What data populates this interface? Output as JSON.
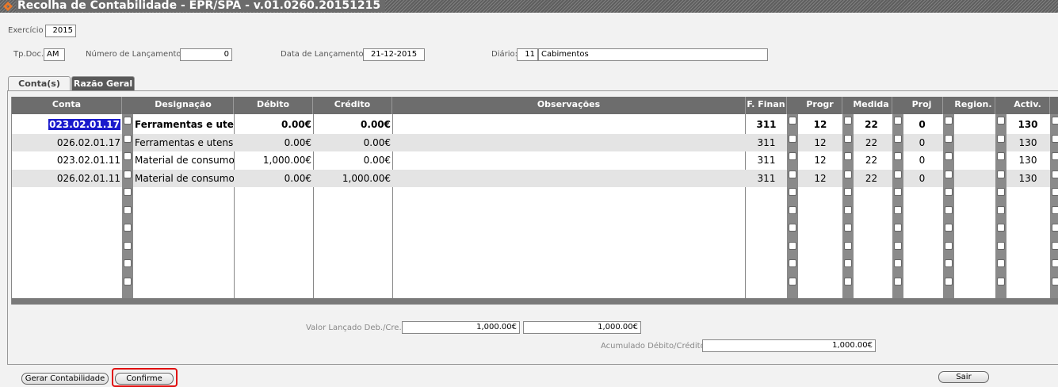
{
  "window": {
    "title": "Recolha de Contabilidade - EPR/SPA - v.01.0260.20151215"
  },
  "header": {
    "exercicio_label": "Exercício",
    "exercicio_value": "2015",
    "tpdoc_label": "Tp.Doc.",
    "tpdoc_value": "AM",
    "numero_label": "Número de Lançamento:",
    "numero_value": "0",
    "data_label": "Data de Lançamento:",
    "data_value": "21-12-2015",
    "diario_label": "Diário:",
    "diario_code": "11",
    "diario_name": "Cabimentos"
  },
  "tabs": [
    {
      "label": "Conta(s)",
      "active": false
    },
    {
      "label": "Razão Geral",
      "active": true
    }
  ],
  "table": {
    "columns": [
      "Conta",
      "Designação",
      "Débito",
      "Crédito",
      "Observações",
      "F. Finan",
      "Progr",
      "Medida",
      "Proj",
      "Region.",
      "Activ."
    ],
    "rows": [
      {
        "conta": "023.02.01.17",
        "designacao": "Ferramentas e utensilios",
        "debito": "0.00€",
        "credito": "0.00€",
        "observacoes": "",
        "ffinan": "311",
        "progr": "12",
        "medida": "22",
        "proj": "0",
        "region": "",
        "activ": "130"
      },
      {
        "conta": "026.02.01.17",
        "designacao": "Ferramentas e utensilios",
        "debito": "0.00€",
        "credito": "0.00€",
        "observacoes": "",
        "ffinan": "311",
        "progr": "12",
        "medida": "22",
        "proj": "0",
        "region": "",
        "activ": "130"
      },
      {
        "conta": "023.02.01.11",
        "designacao": "Material de consumo",
        "debito": "1,000.00€",
        "credito": "0.00€",
        "observacoes": "",
        "ffinan": "311",
        "progr": "12",
        "medida": "22",
        "proj": "0",
        "region": "",
        "activ": "130"
      },
      {
        "conta": "026.02.01.11",
        "designacao": "Material de consumo",
        "debito": "0.00€",
        "credito": "1,000.00€",
        "observacoes": "",
        "ffinan": "311",
        "progr": "12",
        "medida": "22",
        "proj": "0",
        "region": "",
        "activ": "130"
      }
    ]
  },
  "totals": {
    "valor_label": "Valor Lançado Deb./Cre.",
    "valor_debito": "1,000.00€",
    "valor_credito": "1,000.00€",
    "acumulado_label": "Acumulado Débito/Crédito:",
    "acumulado_value": "1,000.00€"
  },
  "buttons": {
    "gerar": "Gerar Contabilidade",
    "confirme": "Confirme",
    "sair": "Sair"
  },
  "colors": {
    "title_bar": "#6b6b6b",
    "header": "#6d6d6d",
    "selection": "#1a1acc",
    "highlight": "#e01010"
  }
}
